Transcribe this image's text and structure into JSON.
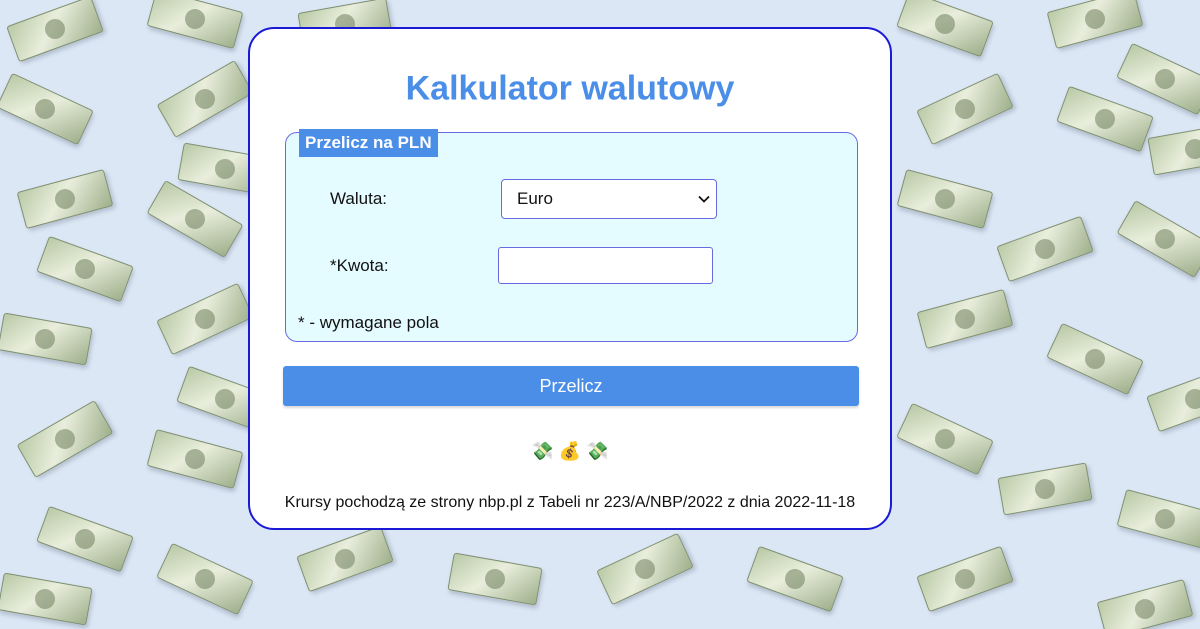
{
  "page": {
    "title": "Kalkulator walutowy",
    "form": {
      "legend": "Przelicz na PLN",
      "currency_label": "Waluta:",
      "currency_selected": "Euro",
      "amount_label": "*Kwota:",
      "amount_value": "",
      "required_note": "* - wymagane pola"
    },
    "submit_label": "Przelicz",
    "emojis": "💸 💰 💸",
    "footer": "Krursy pochodzą ze strony nbp.pl z Tabeli nr 223/A/NBP/2022 z dnia 2022-11-18"
  },
  "colors": {
    "accent": "#4a8ee8",
    "border": "#1a1ad6",
    "fieldset_bg": "#e4fcff",
    "page_bg": "#dbe7f5"
  },
  "icons": {
    "select_arrow": "chevron-down-icon",
    "background": "banknote-pattern"
  }
}
